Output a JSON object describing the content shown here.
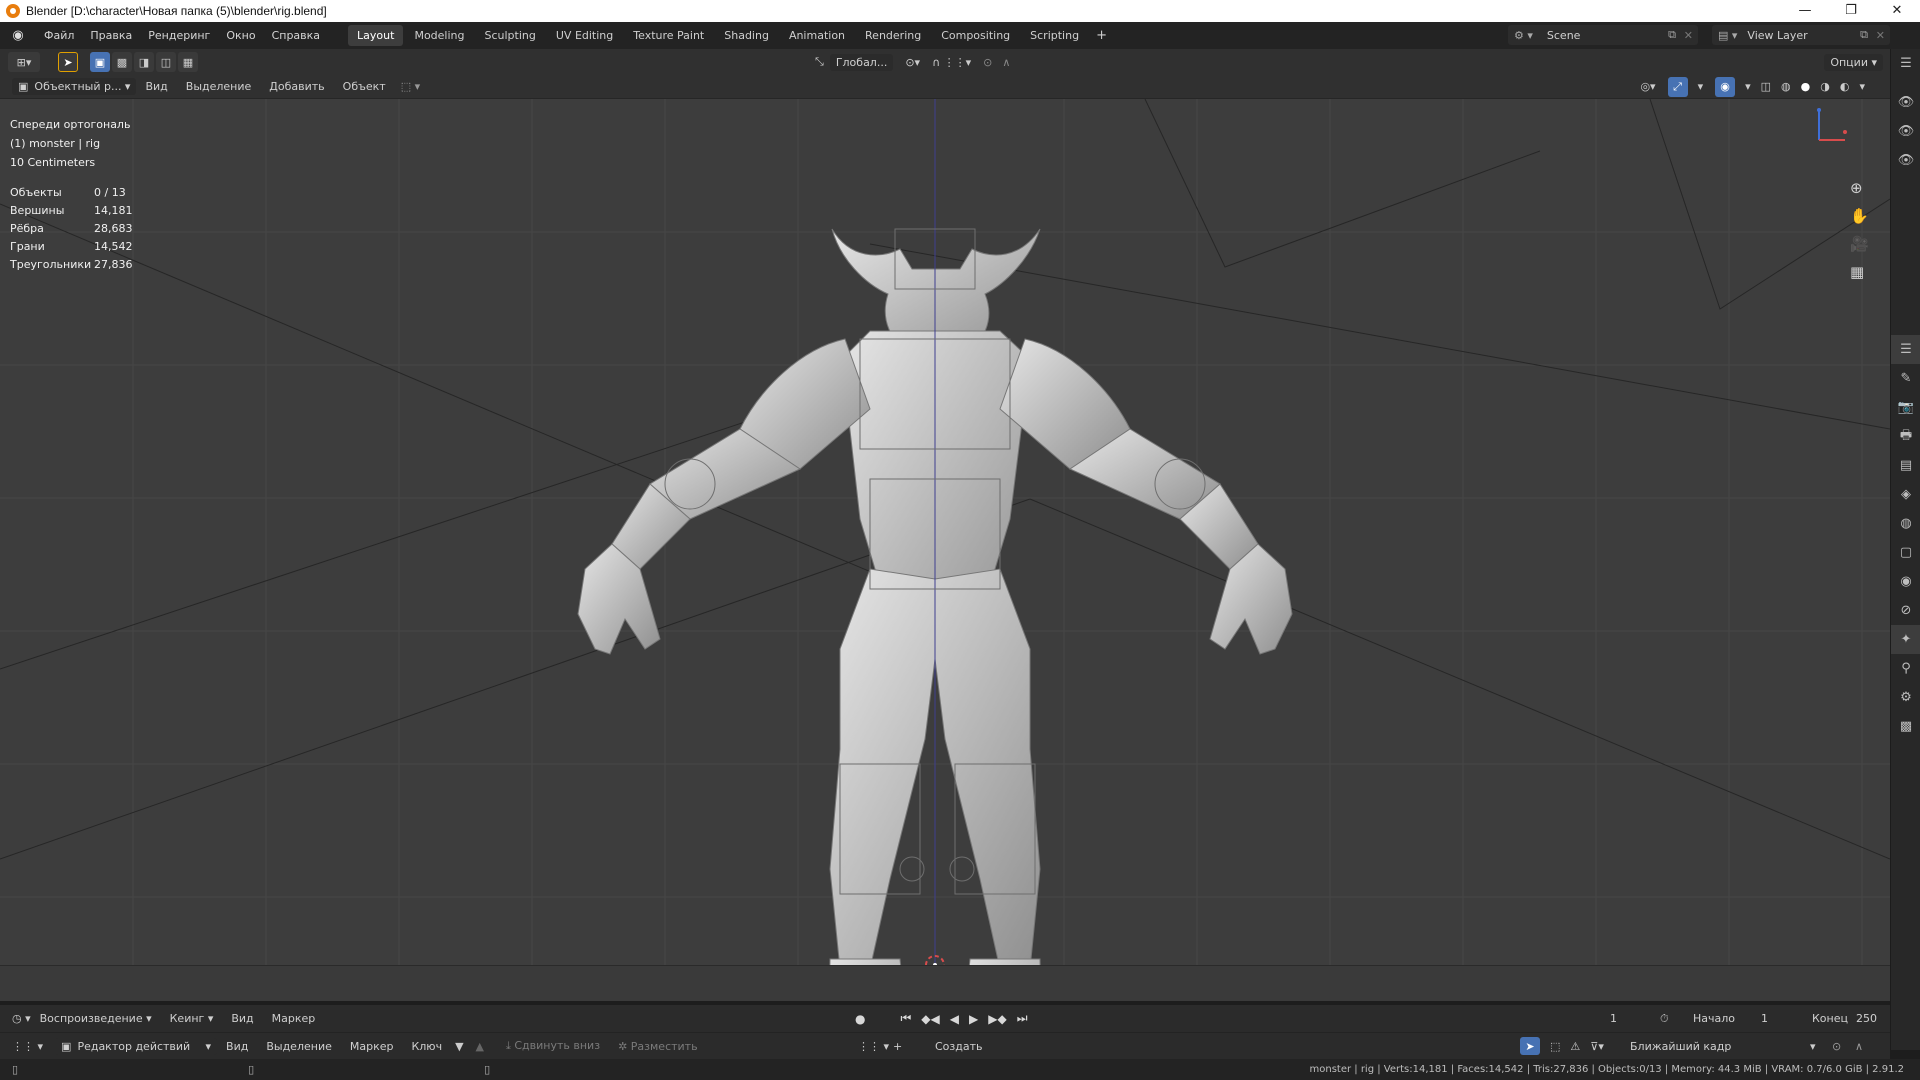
{
  "window": {
    "title": "Blender [D:\\character\\Новая папка (5)\\blender\\rig.blend]",
    "controls": [
      "—",
      "❐",
      "✕"
    ]
  },
  "menu": [
    "Файл",
    "Правка",
    "Рендеринг",
    "Окно",
    "Справка"
  ],
  "workspaces": [
    "Layout",
    "Modeling",
    "Sculpting",
    "UV Editing",
    "Texture Paint",
    "Shading",
    "Animation",
    "Rendering",
    "Compositing",
    "Scripting"
  ],
  "active_workspace": "Layout",
  "scene": {
    "name": "Scene",
    "view_layer": "View Layer"
  },
  "header": {
    "transform_orientation": "Глобал...",
    "options_label": "Опции"
  },
  "viewport_header": {
    "mode": "Объектный р...",
    "menus": [
      "Вид",
      "Выделение",
      "Добавить",
      "Объект"
    ]
  },
  "viewport": {
    "view_name": "Спереди ортогональ",
    "object_info": "(1) monster | rig",
    "scale": "10 Centimeters",
    "stats": [
      {
        "label": "Объекты",
        "value": "0 / 13"
      },
      {
        "label": "Вершины",
        "value": "14,181"
      },
      {
        "label": "Рёбра",
        "value": "28,683"
      },
      {
        "label": "Грани",
        "value": "14,542"
      },
      {
        "label": "Треугольники",
        "value": "27,836"
      }
    ]
  },
  "timeline": {
    "menus": [
      "Воспроизведение",
      "Кеинг",
      "Вид",
      "Маркер"
    ],
    "current_frame": "1",
    "start_label": "Начало",
    "start": "1",
    "end_label": "Конец",
    "end": "250"
  },
  "action_editor": {
    "editor": "Редактор действий",
    "menus": [
      "Вид",
      "Выделение",
      "Маркер",
      "Ключ"
    ],
    "push_down": "Сдвинуть вниз",
    "stash": "Разместить",
    "new": "Создать",
    "snapping": "Ближайший кадр"
  },
  "status": "monster | rig | Verts:14,181 | Faces:14,542 | Tris:27,836 | Objects:0/13 | Memory: 44.3 MiB | VRAM: 0.7/6.0 GiB | 2.91.2",
  "colors": {
    "accent": "#4772b3",
    "viewport_bg": "#3d3d3d",
    "model": "#c9c9c9",
    "blender_orange": "#e87d0d"
  }
}
